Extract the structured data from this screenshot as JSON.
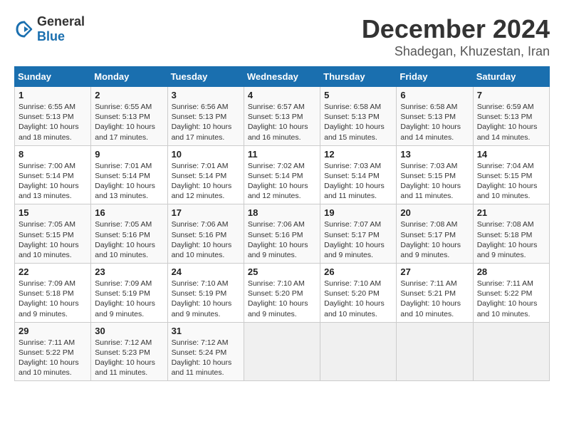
{
  "logo": {
    "general": "General",
    "blue": "Blue"
  },
  "title": "December 2024",
  "location": "Shadegan, Khuzestan, Iran",
  "days_of_week": [
    "Sunday",
    "Monday",
    "Tuesday",
    "Wednesday",
    "Thursday",
    "Friday",
    "Saturday"
  ],
  "weeks": [
    [
      {
        "day": "1",
        "sunrise": "6:55 AM",
        "sunset": "5:13 PM",
        "daylight": "10 hours and 18 minutes."
      },
      {
        "day": "2",
        "sunrise": "6:55 AM",
        "sunset": "5:13 PM",
        "daylight": "10 hours and 17 minutes."
      },
      {
        "day": "3",
        "sunrise": "6:56 AM",
        "sunset": "5:13 PM",
        "daylight": "10 hours and 17 minutes."
      },
      {
        "day": "4",
        "sunrise": "6:57 AM",
        "sunset": "5:13 PM",
        "daylight": "10 hours and 16 minutes."
      },
      {
        "day": "5",
        "sunrise": "6:58 AM",
        "sunset": "5:13 PM",
        "daylight": "10 hours and 15 minutes."
      },
      {
        "day": "6",
        "sunrise": "6:58 AM",
        "sunset": "5:13 PM",
        "daylight": "10 hours and 14 minutes."
      },
      {
        "day": "7",
        "sunrise": "6:59 AM",
        "sunset": "5:13 PM",
        "daylight": "10 hours and 14 minutes."
      }
    ],
    [
      {
        "day": "8",
        "sunrise": "7:00 AM",
        "sunset": "5:14 PM",
        "daylight": "10 hours and 13 minutes."
      },
      {
        "day": "9",
        "sunrise": "7:01 AM",
        "sunset": "5:14 PM",
        "daylight": "10 hours and 13 minutes."
      },
      {
        "day": "10",
        "sunrise": "7:01 AM",
        "sunset": "5:14 PM",
        "daylight": "10 hours and 12 minutes."
      },
      {
        "day": "11",
        "sunrise": "7:02 AM",
        "sunset": "5:14 PM",
        "daylight": "10 hours and 12 minutes."
      },
      {
        "day": "12",
        "sunrise": "7:03 AM",
        "sunset": "5:14 PM",
        "daylight": "10 hours and 11 minutes."
      },
      {
        "day": "13",
        "sunrise": "7:03 AM",
        "sunset": "5:15 PM",
        "daylight": "10 hours and 11 minutes."
      },
      {
        "day": "14",
        "sunrise": "7:04 AM",
        "sunset": "5:15 PM",
        "daylight": "10 hours and 10 minutes."
      }
    ],
    [
      {
        "day": "15",
        "sunrise": "7:05 AM",
        "sunset": "5:15 PM",
        "daylight": "10 hours and 10 minutes."
      },
      {
        "day": "16",
        "sunrise": "7:05 AM",
        "sunset": "5:16 PM",
        "daylight": "10 hours and 10 minutes."
      },
      {
        "day": "17",
        "sunrise": "7:06 AM",
        "sunset": "5:16 PM",
        "daylight": "10 hours and 10 minutes."
      },
      {
        "day": "18",
        "sunrise": "7:06 AM",
        "sunset": "5:16 PM",
        "daylight": "10 hours and 9 minutes."
      },
      {
        "day": "19",
        "sunrise": "7:07 AM",
        "sunset": "5:17 PM",
        "daylight": "10 hours and 9 minutes."
      },
      {
        "day": "20",
        "sunrise": "7:08 AM",
        "sunset": "5:17 PM",
        "daylight": "10 hours and 9 minutes."
      },
      {
        "day": "21",
        "sunrise": "7:08 AM",
        "sunset": "5:18 PM",
        "daylight": "10 hours and 9 minutes."
      }
    ],
    [
      {
        "day": "22",
        "sunrise": "7:09 AM",
        "sunset": "5:18 PM",
        "daylight": "10 hours and 9 minutes."
      },
      {
        "day": "23",
        "sunrise": "7:09 AM",
        "sunset": "5:19 PM",
        "daylight": "10 hours and 9 minutes."
      },
      {
        "day": "24",
        "sunrise": "7:10 AM",
        "sunset": "5:19 PM",
        "daylight": "10 hours and 9 minutes."
      },
      {
        "day": "25",
        "sunrise": "7:10 AM",
        "sunset": "5:20 PM",
        "daylight": "10 hours and 9 minutes."
      },
      {
        "day": "26",
        "sunrise": "7:10 AM",
        "sunset": "5:20 PM",
        "daylight": "10 hours and 10 minutes."
      },
      {
        "day": "27",
        "sunrise": "7:11 AM",
        "sunset": "5:21 PM",
        "daylight": "10 hours and 10 minutes."
      },
      {
        "day": "28",
        "sunrise": "7:11 AM",
        "sunset": "5:22 PM",
        "daylight": "10 hours and 10 minutes."
      }
    ],
    [
      {
        "day": "29",
        "sunrise": "7:11 AM",
        "sunset": "5:22 PM",
        "daylight": "10 hours and 10 minutes."
      },
      {
        "day": "30",
        "sunrise": "7:12 AM",
        "sunset": "5:23 PM",
        "daylight": "10 hours and 11 minutes."
      },
      {
        "day": "31",
        "sunrise": "7:12 AM",
        "sunset": "5:24 PM",
        "daylight": "10 hours and 11 minutes."
      },
      null,
      null,
      null,
      null
    ]
  ]
}
